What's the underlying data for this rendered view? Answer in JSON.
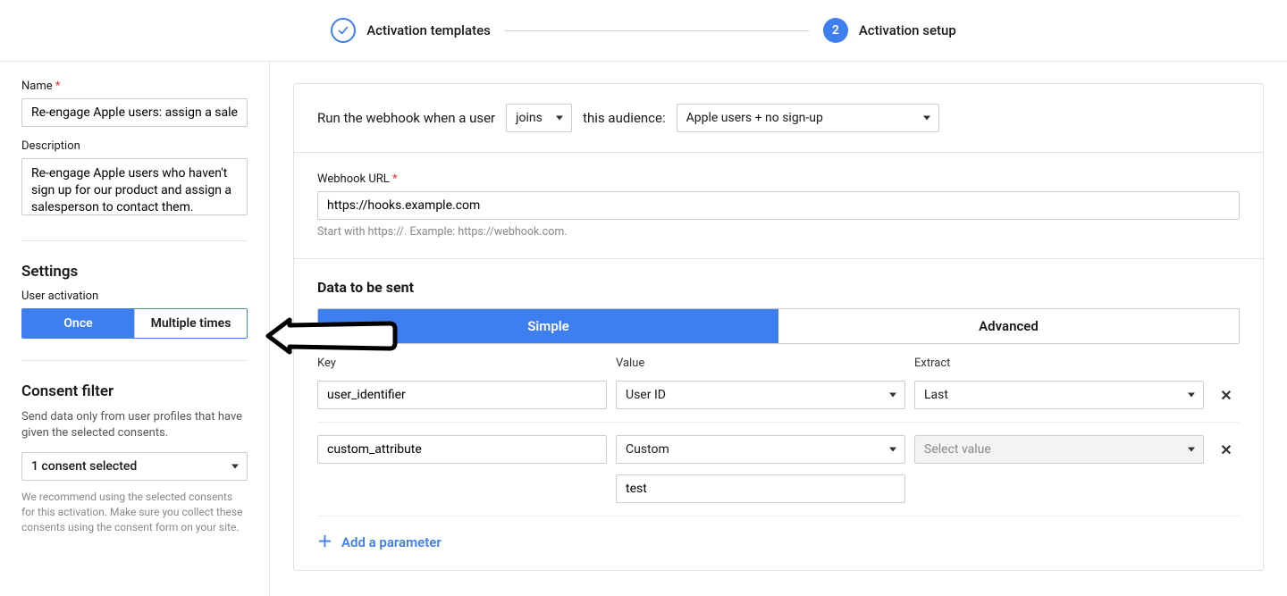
{
  "stepper": {
    "step1_label": "Activation templates",
    "step2_number": "2",
    "step2_label": "Activation setup"
  },
  "sidebar": {
    "name_label": "Name",
    "name_value": "Re-engage Apple users: assign a salesperson",
    "description_label": "Description",
    "description_value": "Re-engage Apple users who haven't sign up for our product and assign a salesperson to contact them.",
    "settings_heading": "Settings",
    "user_activation_label": "User activation",
    "activation_once": "Once",
    "activation_multiple": "Multiple times",
    "consent_heading": "Consent filter",
    "consent_desc": "Send data only from user profiles that have given the selected consents.",
    "consent_selected": "1 consent selected",
    "consent_fineprint": "We recommend using the selected consents for this activation. Make sure you collect these consents using the consent form on your site."
  },
  "main": {
    "run_prefix": "Run the webhook when a user",
    "run_action": "joins",
    "run_suffix": "this audience:",
    "audience_value": "Apple users + no sign-up",
    "webhook_url_label": "Webhook URL",
    "webhook_url_value": "https://hooks.example.com",
    "webhook_hint": "Start with https://. Example: https://webhook.com.",
    "data_section_title": "Data to be sent",
    "tab_simple": "Simple",
    "tab_advanced": "Advanced",
    "col_key": "Key",
    "col_value": "Value",
    "col_extract": "Extract",
    "rows": [
      {
        "key": "user_identifier",
        "value": "User ID",
        "extract": "Last",
        "extra": null
      },
      {
        "key": "custom_attribute",
        "value": "Custom",
        "extract_placeholder": "Select value",
        "extra": "test"
      }
    ],
    "add_param_label": "Add a parameter"
  }
}
